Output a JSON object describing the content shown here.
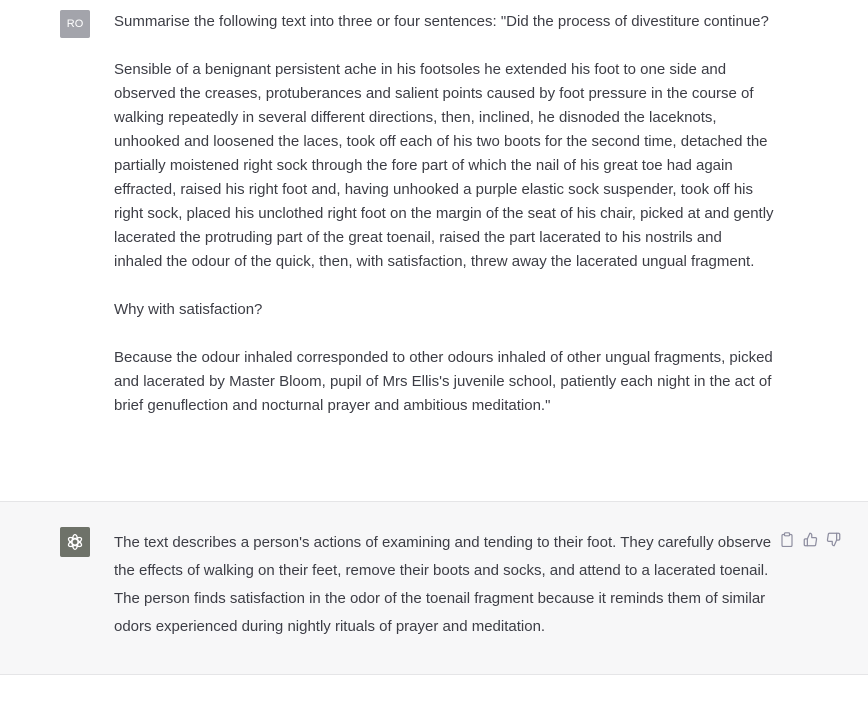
{
  "user_message": {
    "avatar_initials": "RO",
    "paragraphs": [
      "Summarise the following text into three or four sentences: \"Did the process of divestiture continue?",
      "Sensible of a benignant persistent ache in his footsoles he extended his foot to one side and observed the creases, protuberances and salient points caused by foot pressure in the course of walking repeatedly in several different directions, then, inclined, he disnoded the laceknots, unhooked and loosened the laces, took off each of his two boots for the second time, detached the partially moistened right sock through the fore part of which the nail of his great toe had again effracted, raised his right foot and, having unhooked a purple elastic sock suspender, took off his right sock, placed his unclothed right foot on the margin of the seat of his chair, picked at and gently lacerated the protruding part of the great toenail, raised the part lacerated to his nostrils and inhaled the odour of the quick, then, with satisfaction, threw away the lacerated ungual fragment.",
      "Why with satisfaction?",
      "Because the odour inhaled corresponded to other odours inhaled of other ungual fragments, picked and lacerated by Master Bloom, pupil of Mrs Ellis's juvenile school, patiently each night in the act of brief genuflection and nocturnal prayer and ambitious meditation.\""
    ]
  },
  "assistant_message": {
    "avatar_icon": "openai-logo-icon",
    "text": "The text describes a person's actions of examining and tending to their foot. They carefully observe the effects of walking on their feet, remove their boots and socks, and attend to a lacerated toenail. The person finds satisfaction in the odor of the toenail fragment because it reminds them of similar odors experienced during nightly rituals of prayer and meditation.",
    "actions": [
      "clipboard-icon",
      "thumbs-up-icon",
      "thumbs-down-icon"
    ]
  },
  "colors": {
    "assistant_bg": "#f7f7f8",
    "user_avatar_bg": "#a3a4ab",
    "bot_avatar_bg": "#6e7269",
    "text": "#3c3d45"
  }
}
